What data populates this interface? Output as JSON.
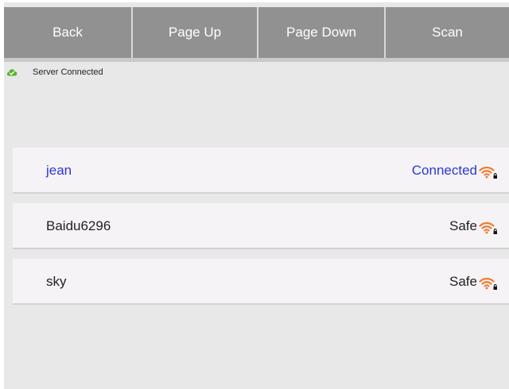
{
  "toolbar": {
    "back_label": "Back",
    "page_up_label": "Page Up",
    "page_down_label": "Page Down",
    "scan_label": "Scan"
  },
  "status": {
    "text": "Server Connected",
    "icon": "cloud-check-icon",
    "icon_color": "#57b32b"
  },
  "networks": [
    {
      "ssid": "jean",
      "state": "Connected",
      "connected": true,
      "icon": "wifi-locked-icon"
    },
    {
      "ssid": "Baidu6296",
      "state": "Safe",
      "connected": false,
      "icon": "wifi-locked-icon"
    },
    {
      "ssid": "sky",
      "state": "Safe",
      "connected": false,
      "icon": "wifi-locked-icon"
    }
  ],
  "colors": {
    "toolbar_button": "#919191",
    "connected_text": "#2b37d6",
    "wifi_signal": "#f07c2e",
    "background": "#e9e8e9"
  }
}
